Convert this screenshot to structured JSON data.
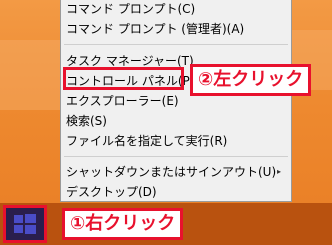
{
  "menu": {
    "items": [
      {
        "label": "コマンド プロンプト(C)"
      },
      {
        "label": "コマンド プロンプト (管理者)(A)"
      },
      {
        "label": "タスク マネージャー(T)"
      },
      {
        "label": "コントロール パネル(P)"
      },
      {
        "label": "エクスプローラー(E)"
      },
      {
        "label": "検索(S)"
      },
      {
        "label": "ファイル名を指定して実行(R)"
      },
      {
        "label": "シャットダウンまたはサインアウト(U)"
      },
      {
        "label": "デスクトップ(D)"
      }
    ],
    "submenu_arrow": "▸"
  },
  "annotations": {
    "step2": "②左クリック",
    "step1": "①右クリック"
  },
  "colors": {
    "accent": "#e8112d",
    "desktop": "#e87722",
    "taskbar": "#b9520f",
    "menu_bg": "#f0f0f0"
  },
  "icons": {
    "start": "windows-logo-icon"
  }
}
